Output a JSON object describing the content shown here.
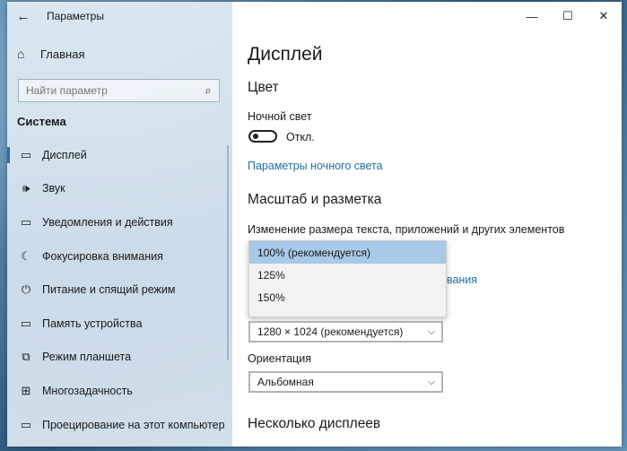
{
  "window": {
    "app_title": "Параметры",
    "back_icon": "←",
    "minimize_icon": "—",
    "maximize_icon": "☐",
    "close_icon": "✕"
  },
  "sidebar": {
    "home_label": "Главная",
    "home_icon": "⌂",
    "search_placeholder": "Найти параметр",
    "search_icon": "⌕",
    "section": "Система",
    "items": [
      {
        "icon": "▭",
        "label": "Дисплей"
      },
      {
        "icon": "🕪",
        "label": "Звук"
      },
      {
        "icon": "▭",
        "label": "Уведомления и действия"
      },
      {
        "icon": "☾",
        "label": "Фокусировка внимания"
      },
      {
        "icon": "⏻",
        "label": "Питание и спящий режим"
      },
      {
        "icon": "▭",
        "label": "Память устройства"
      },
      {
        "icon": "⧉",
        "label": "Режим планшета"
      },
      {
        "icon": "⊞",
        "label": "Многозадачность"
      },
      {
        "icon": "▭",
        "label": "Проецирование на этот компьютер"
      }
    ]
  },
  "main": {
    "title": "Дисплей",
    "color_heading": "Цвет",
    "night_light_label": "Ночной свет",
    "night_light_state": "Откл.",
    "night_light_link": "Параметры ночного света",
    "scale_heading": "Масштаб и разметка",
    "scale_label": "Изменение размера текста, приложений и других элементов",
    "scale_options": [
      "100% (рекомендуется)",
      "125%",
      "150%"
    ],
    "partial_link": "ования",
    "resolution_value": "1280 × 1024 (рекомендуется)",
    "orientation_label": "Ориентация",
    "orientation_value": "Альбомная",
    "multi_display_heading": "Несколько дисплеев",
    "chevron_icon": "⌵"
  },
  "colors": {
    "accent": "#1d6fa5",
    "selected_option": "#a8c9e8"
  }
}
